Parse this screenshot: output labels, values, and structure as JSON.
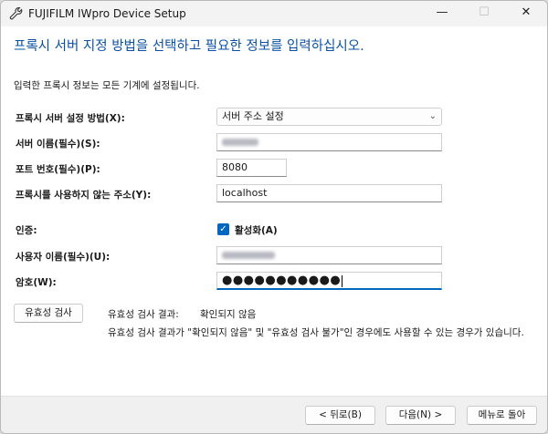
{
  "window": {
    "title": "FUJIFILM IWpro Device Setup",
    "controls": {
      "minimize": "—",
      "maximize": "☐",
      "close": "✕"
    }
  },
  "heading": "프록시 서버 지정 방법을 선택하고 필요한 정보를 입력하십시오.",
  "info": "입력한 프록시 정보는 모든 기계에 설정됩니다.",
  "form": {
    "method_label": "프록시 서버 설정 방법(X):",
    "method_value": "서버 주소 설정",
    "server_label": "서버 이름(필수)(S):",
    "port_label": "포트 번호(필수)(P):",
    "port_value": "8080",
    "noproxy_label": "프록시를 사용하지 않는 주소(Y):",
    "noproxy_value": "localhost",
    "auth_label": "인증:",
    "auth_checkbox_label": "활성화(A)",
    "auth_checked": true,
    "username_label": "사용자 이름(필수)(U):",
    "password_label": "암호(W):",
    "password_value": "●●●●●●●●●●●"
  },
  "validation": {
    "button": "유효성 검사",
    "result_label": "유효성 검사 결과:",
    "result_value": "확인되지 않음",
    "note": "유효성 검사 결과가 \"확인되지 않음\" 및 \"유효성 검사 불가\"인 경우에도 사용할 수 있는 경우가 있습니다."
  },
  "footer": {
    "back": "< 뒤로(B)",
    "next": "다음(N) >",
    "menu": "메뉴로 돌아"
  },
  "colors": {
    "heading": "#0b51a3",
    "accent": "#0067c0"
  }
}
